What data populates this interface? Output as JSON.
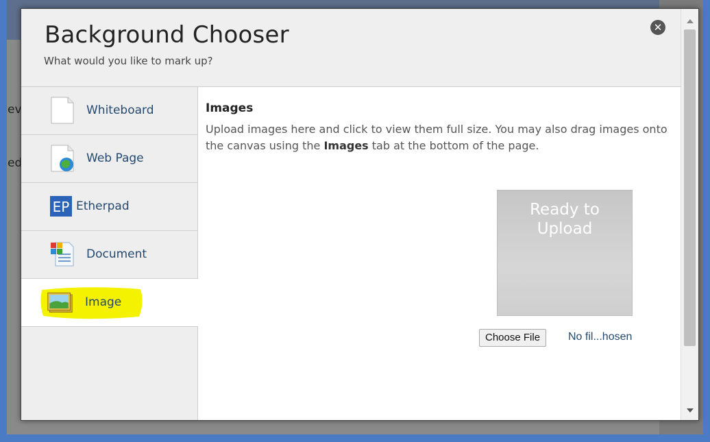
{
  "background": {
    "fragment_1": "ev",
    "fragment_2": "ed"
  },
  "modal": {
    "title": "Background Chooser",
    "subtitle": "What would you like to mark up?",
    "close_icon": "close-icon"
  },
  "sidebar": {
    "items": [
      {
        "label": "Whiteboard",
        "icon": "blank-document-icon",
        "active": false
      },
      {
        "label": "Web Page",
        "icon": "web-page-icon",
        "active": false
      },
      {
        "label": "Etherpad",
        "icon": "etherpad-icon",
        "icon_text": "EP",
        "active": false
      },
      {
        "label": "Document",
        "icon": "document-icon",
        "active": false
      },
      {
        "label": "Image",
        "icon": "image-icon",
        "active": true,
        "highlight_color": "#f4f200"
      }
    ]
  },
  "content": {
    "title": "Images",
    "desc_part1": "Upload images here and click to view them full size. You may also drag images onto the canvas using the ",
    "desc_bold": "Images",
    "desc_part2": " tab at the bottom of the page.",
    "upload_line1": "Ready to",
    "upload_line2": "Upload",
    "choose_file_label": "Choose File",
    "file_status": "No fil...hosen"
  },
  "colors": {
    "accent_link": "#24496f",
    "highlight": "#f4f200",
    "etherpad_blue": "#2a63b8"
  }
}
